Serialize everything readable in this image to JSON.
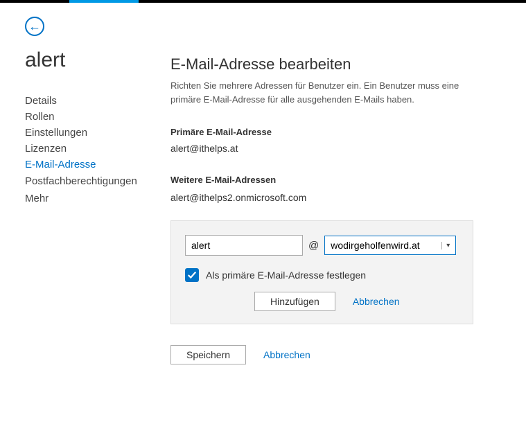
{
  "page_title": "alert",
  "nav": {
    "items": [
      {
        "label": "Details"
      },
      {
        "label": "Rollen"
      },
      {
        "label": "Einstellungen"
      },
      {
        "label": "Lizenzen"
      },
      {
        "label": "E-Mail-Adresse"
      },
      {
        "label": "Postfachberechtigungen"
      },
      {
        "label": "Mehr"
      }
    ]
  },
  "main": {
    "heading": "E-Mail-Adresse bearbeiten",
    "description": "Richten Sie mehrere Adressen für Benutzer ein. Ein Benutzer muss eine primäre E-Mail-Adresse für alle ausgehenden E-Mails haben.",
    "primary_label": "Primäre E-Mail-Adresse",
    "primary_value": "alert@ithelps.at",
    "other_label": "Weitere E-Mail-Adressen",
    "other_emails": [
      "alert@ithelps2.onmicrosoft.com"
    ],
    "add_panel": {
      "local_part": "alert",
      "at": "@",
      "domain": "wodirgeholfenwird.at",
      "set_primary_label": "Als primäre E-Mail-Adresse festlegen",
      "add_btn": "Hinzufügen",
      "cancel_link": "Abbrechen"
    },
    "footer": {
      "save_btn": "Speichern",
      "cancel_link": "Abbrechen"
    }
  }
}
